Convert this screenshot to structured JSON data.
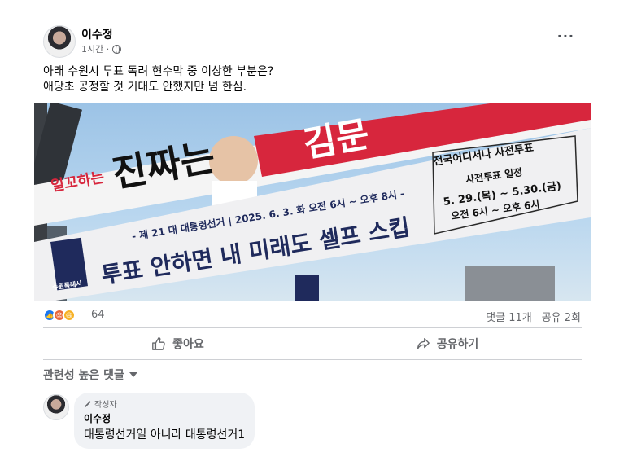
{
  "post": {
    "author": "이수정",
    "time": "1시간 ·",
    "more_label": "···",
    "text_line1": "아래 수원시 투표 독려 현수막 중 이상한 부분은?",
    "text_line2": "애당초 공정할 것 기대도 안했지만 넘 한심."
  },
  "banner": {
    "upper_slogan": "진짜는",
    "upper_tag": "일꼬하는",
    "upper_right": "김문",
    "right_title": "전국어디서나 사전투표",
    "right_sub": "사전투표 일정",
    "right_dates": "5. 29.(목) ~ 5.30.(금)",
    "right_hours": "오전 6시 ~ 오후 6시",
    "date_line": "- 제 21 대 대통령선거 | 2025. 6. 3. 화 오전 6시 ~ 오후 8시 -",
    "main_slogan": "투표 안하면 내 미래도 셀프 스킵",
    "logo_label": "수원특례시"
  },
  "reactions": {
    "count": "64",
    "comments": "댓글 11개",
    "shares": "공유 2회"
  },
  "actions": {
    "like": "좋아요",
    "share": "공유하기"
  },
  "comments": {
    "sort_label": "관련성 높은 댓글",
    "items": [
      {
        "badge": "작성자",
        "author": "이수정",
        "text": "대통령선거일 아니라 대통령선거1"
      }
    ]
  },
  "colors": {
    "accent": "#1877f2",
    "banner_red": "#d7263d",
    "banner_navy": "#1f2a5c",
    "banner_white": "#f4f4f4"
  }
}
